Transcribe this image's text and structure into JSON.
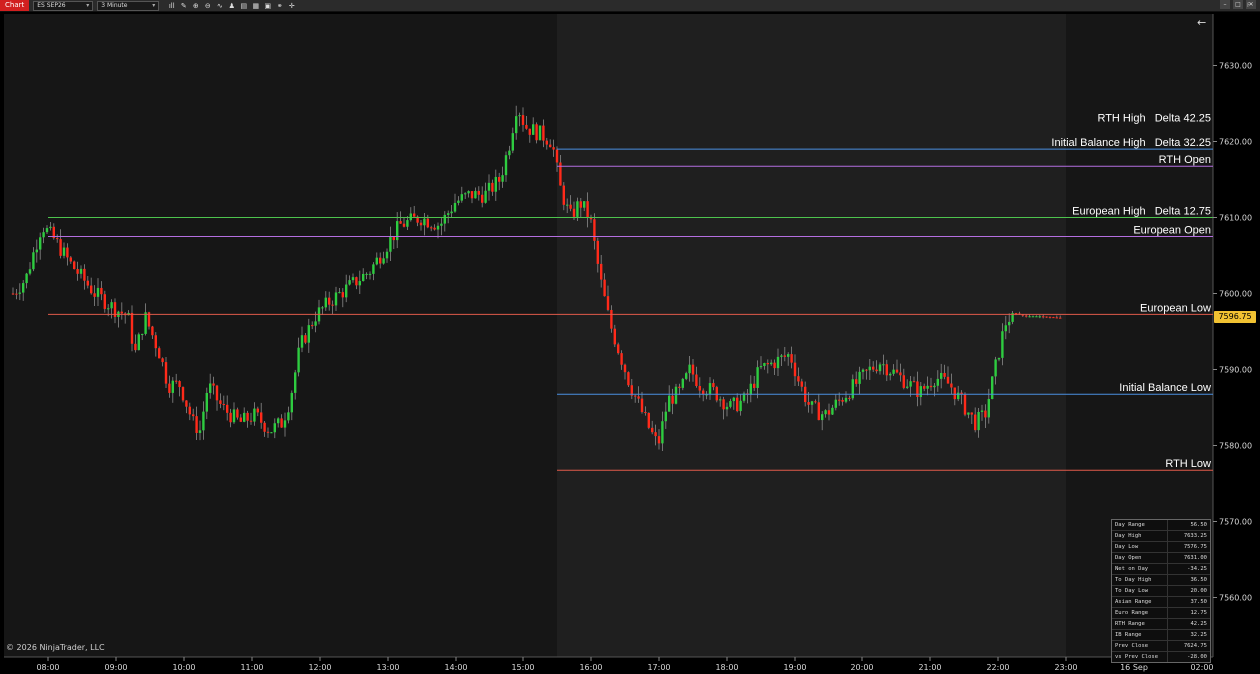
{
  "toolbar": {
    "tab_label": "Chart",
    "instrument": "ES SEP26",
    "interval": "3 Minute",
    "icons": [
      "bar-type-icon",
      "draw-tools-icon",
      "zoom-in-icon",
      "zoom-out-icon",
      "indicators-icon",
      "strategies-icon",
      "properties-icon",
      "templates-icon",
      "data-box-icon",
      "link-icon",
      "crosshair-icon"
    ],
    "corner_label": "F"
  },
  "chart": {
    "price_axis_labels": [
      "7630.00",
      "7620.00",
      "7610.00",
      "7600.00",
      "7590.00",
      "7580.00",
      "7570.00",
      "7560.00"
    ],
    "time_axis_labels": [
      "08:00",
      "09:00",
      "10:00",
      "11:00",
      "12:00",
      "13:00",
      "14:00",
      "15:00",
      "16:00",
      "17:00",
      "18:00",
      "19:00",
      "20:00",
      "21:00",
      "22:00",
      "23:00",
      "16 Sep",
      "02:00"
    ],
    "last_price": "7596.75",
    "copyright": "© 2026 NinjaTrader, LLC",
    "colors": {
      "up": "#2ecc40",
      "down": "#ff2a1a",
      "background": "#161616",
      "session_shade": "#1f1f1f",
      "price_tag": "#f1c232"
    }
  },
  "levels": [
    {
      "label": "RTH High   Delta 42.25",
      "price": 7622.25,
      "color": "#ffffff",
      "line": false
    },
    {
      "label": "Initial Balance High   Delta 32.25",
      "price": 7619.0,
      "color": "#4a8fe0",
      "line": true
    },
    {
      "label": "RTH Open",
      "price": 7616.75,
      "color": "#b46ee0",
      "line": true
    },
    {
      "label": "European High   Delta 12.75",
      "price": 7610.0,
      "color": "#4dc34d",
      "line": true
    },
    {
      "label": "European Open",
      "price": 7607.5,
      "color": "#b46ee0",
      "line": true
    },
    {
      "label": "European Low",
      "price": 7597.25,
      "color": "#e05a4a",
      "line": true
    },
    {
      "label": "Initial Balance Low",
      "price": 7586.75,
      "color": "#4a8fe0",
      "line": true
    },
    {
      "label": "RTH Low",
      "price": 7576.75,
      "color": "#e05a4a",
      "line": true
    }
  ],
  "stats": [
    {
      "key": "Day Range",
      "value": "56.50"
    },
    {
      "key": "Day High",
      "value": "7633.25"
    },
    {
      "key": "Day Low",
      "value": "7576.75"
    },
    {
      "key": "Day Open",
      "value": "7631.00"
    },
    {
      "key": "Net on Day",
      "value": "-34.25"
    },
    {
      "key": "To Day High",
      "value": "36.50"
    },
    {
      "key": "To Day Low",
      "value": "20.00"
    },
    {
      "key": "Asian Range",
      "value": "37.50"
    },
    {
      "key": "Euro Range",
      "value": "12.75"
    },
    {
      "key": "RTH Range",
      "value": "42.25"
    },
    {
      "key": "IB Range",
      "value": "32.25"
    },
    {
      "key": "Prev Close",
      "value": "7624.75"
    },
    {
      "key": "vs Prev Close",
      "value": "-28.00"
    }
  ]
}
